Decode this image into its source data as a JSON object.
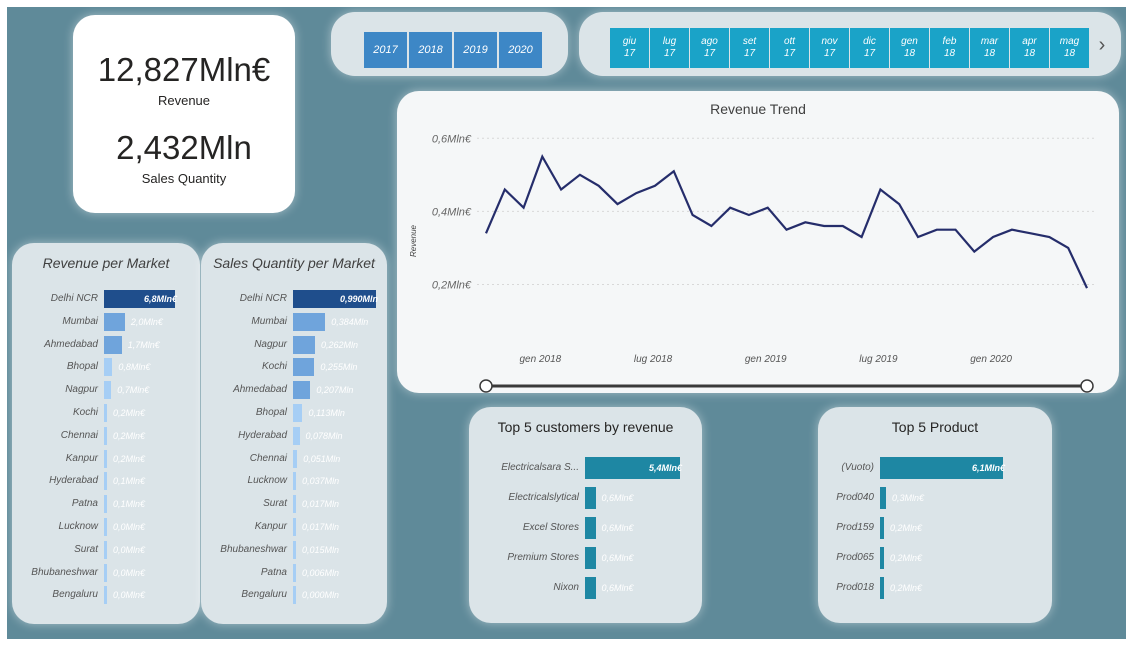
{
  "kpi": {
    "revenue_value": "12,827Mln€",
    "revenue_label": "Revenue",
    "quantity_value": "2,432Mln",
    "quantity_label": "Sales Quantity"
  },
  "year_slicer": [
    "2017",
    "2018",
    "2019",
    "2020"
  ],
  "month_slicer": [
    {
      "m": "giu",
      "y": "17"
    },
    {
      "m": "lug",
      "y": "17"
    },
    {
      "m": "ago",
      "y": "17"
    },
    {
      "m": "set",
      "y": "17"
    },
    {
      "m": "ott",
      "y": "17"
    },
    {
      "m": "nov",
      "y": "17"
    },
    {
      "m": "dic",
      "y": "17"
    },
    {
      "m": "gen",
      "y": "18"
    },
    {
      "m": "feb",
      "y": "18"
    },
    {
      "m": "mar",
      "y": "18"
    },
    {
      "m": "apr",
      "y": "18"
    },
    {
      "m": "mag",
      "y": "18"
    }
  ],
  "month_next_icon": "chevron-right-icon",
  "trend": {
    "title": "Revenue Trend",
    "ylabel": "Revenue",
    "y_ticks": [
      "0,6Mln€",
      "0,4Mln€",
      "0,2Mln€"
    ],
    "x_ticks": [
      "gen 2018",
      "lug 2018",
      "gen 2019",
      "lug 2019",
      "gen 2020"
    ],
    "line_color": "#252d6b"
  },
  "revenue_market": {
    "title": "Revenue per Market",
    "rows": [
      {
        "label": "Delhi NCR",
        "value": "6,8Mln€"
      },
      {
        "label": "Mumbai",
        "value": "2,0Mln€"
      },
      {
        "label": "Ahmedabad",
        "value": "1,7Mln€"
      },
      {
        "label": "Bhopal",
        "value": "0,8Mln€"
      },
      {
        "label": "Nagpur",
        "value": "0,7Mln€"
      },
      {
        "label": "Kochi",
        "value": "0,2Mln€"
      },
      {
        "label": "Chennai",
        "value": "0,2Mln€"
      },
      {
        "label": "Kanpur",
        "value": "0,2Mln€"
      },
      {
        "label": "Hyderabad",
        "value": "0,1Mln€"
      },
      {
        "label": "Patna",
        "value": "0,1Mln€"
      },
      {
        "label": "Lucknow",
        "value": "0,0Mln€"
      },
      {
        "label": "Surat",
        "value": "0,0Mln€"
      },
      {
        "label": "Bhubaneshwar",
        "value": "0,0Mln€"
      },
      {
        "label": "Bengaluru",
        "value": "0,0Mln€"
      }
    ]
  },
  "quantity_market": {
    "title": "Sales Quantity per Market",
    "rows": [
      {
        "label": "Delhi NCR",
        "value": "0,990Mln"
      },
      {
        "label": "Mumbai",
        "value": "0,384Mln"
      },
      {
        "label": "Nagpur",
        "value": "0,262Mln"
      },
      {
        "label": "Kochi",
        "value": "0,255Mln"
      },
      {
        "label": "Ahmedabad",
        "value": "0,207Mln"
      },
      {
        "label": "Bhopal",
        "value": "0,113Mln"
      },
      {
        "label": "Hyderabad",
        "value": "0,078Mln"
      },
      {
        "label": "Chennai",
        "value": "0,051Mln"
      },
      {
        "label": "Lucknow",
        "value": "0,037Mln"
      },
      {
        "label": "Surat",
        "value": "0,017Mln"
      },
      {
        "label": "Kanpur",
        "value": "0,017Mln"
      },
      {
        "label": "Bhubaneshwar",
        "value": "0,015Mln"
      },
      {
        "label": "Patna",
        "value": "0,006Mln"
      },
      {
        "label": "Bengaluru",
        "value": "0,000Mln"
      }
    ]
  },
  "top_customers": {
    "title": "Top 5 customers by revenue",
    "rows": [
      {
        "label": "Electricalsara S...",
        "value": "5,4Mln€"
      },
      {
        "label": "Electricalslytical",
        "value": "0,6Mln€"
      },
      {
        "label": "Excel Stores",
        "value": "0,6Mln€"
      },
      {
        "label": "Premium Stores",
        "value": "0,6Mln€"
      },
      {
        "label": "Nixon",
        "value": "0,6Mln€"
      }
    ]
  },
  "top_products": {
    "title": "Top 5 Product",
    "rows": [
      {
        "label": "(Vuoto)",
        "value": "6,1Mln€"
      },
      {
        "label": "Prod040",
        "value": "0,3Mln€"
      },
      {
        "label": "Prod159",
        "value": "0,2Mln€"
      },
      {
        "label": "Prod065",
        "value": "0,2Mln€"
      },
      {
        "label": "Prod018",
        "value": "0,2Mln€"
      }
    ]
  },
  "chart_data": [
    {
      "type": "line",
      "title": "Revenue Trend",
      "xlabel": "",
      "ylabel": "Revenue",
      "x": [
        "2017-10",
        "2017-11",
        "2017-12",
        "2018-01",
        "2018-02",
        "2018-03",
        "2018-04",
        "2018-05",
        "2018-06",
        "2018-07",
        "2018-08",
        "2018-09",
        "2018-10",
        "2018-11",
        "2018-12",
        "2019-01",
        "2019-02",
        "2019-03",
        "2019-04",
        "2019-05",
        "2019-06",
        "2019-07",
        "2019-08",
        "2019-09",
        "2019-10",
        "2019-11",
        "2019-12",
        "2020-01",
        "2020-02",
        "2020-03",
        "2020-04",
        "2020-05",
        "2020-06"
      ],
      "y": [
        0.34,
        0.46,
        0.41,
        0.55,
        0.46,
        0.5,
        0.47,
        0.42,
        0.45,
        0.47,
        0.51,
        0.39,
        0.36,
        0.41,
        0.39,
        0.41,
        0.35,
        0.37,
        0.36,
        0.36,
        0.33,
        0.46,
        0.42,
        0.33,
        0.35,
        0.35,
        0.29,
        0.33,
        0.35,
        0.34,
        0.33,
        0.3,
        0.19
      ],
      "ylim": [
        0.1,
        0.62
      ],
      "y_ticks": [
        0.2,
        0.4,
        0.6
      ],
      "x_tick_labels": [
        "gen 2018",
        "lug 2018",
        "gen 2019",
        "lug 2019",
        "gen 2020"
      ],
      "grid": true
    },
    {
      "type": "bar",
      "title": "Revenue per Market",
      "categories": [
        "Delhi NCR",
        "Mumbai",
        "Ahmedabad",
        "Bhopal",
        "Nagpur",
        "Kochi",
        "Chennai",
        "Kanpur",
        "Hyderabad",
        "Patna",
        "Lucknow",
        "Surat",
        "Bhubaneshwar",
        "Bengaluru"
      ],
      "values": [
        6.8,
        2.0,
        1.7,
        0.8,
        0.7,
        0.2,
        0.2,
        0.2,
        0.1,
        0.1,
        0.0,
        0.0,
        0.0,
        0.0
      ],
      "orientation": "horizontal"
    },
    {
      "type": "bar",
      "title": "Sales Quantity per Market",
      "categories": [
        "Delhi NCR",
        "Mumbai",
        "Nagpur",
        "Kochi",
        "Ahmedabad",
        "Bhopal",
        "Hyderabad",
        "Chennai",
        "Lucknow",
        "Surat",
        "Kanpur",
        "Bhubaneshwar",
        "Patna",
        "Bengaluru"
      ],
      "values": [
        0.99,
        0.384,
        0.262,
        0.255,
        0.207,
        0.113,
        0.078,
        0.051,
        0.037,
        0.017,
        0.017,
        0.015,
        0.006,
        0.0
      ],
      "orientation": "horizontal"
    },
    {
      "type": "bar",
      "title": "Top 5 customers by revenue",
      "categories": [
        "Electricalsara S...",
        "Electricalslytical",
        "Excel Stores",
        "Premium Stores",
        "Nixon"
      ],
      "values": [
        5.4,
        0.6,
        0.6,
        0.6,
        0.6
      ],
      "orientation": "horizontal"
    },
    {
      "type": "bar",
      "title": "Top 5 Product",
      "categories": [
        "(Vuoto)",
        "Prod040",
        "Prod159",
        "Prod065",
        "Prod018"
      ],
      "values": [
        6.1,
        0.3,
        0.2,
        0.2,
        0.2
      ],
      "orientation": "horizontal"
    }
  ],
  "colors": {
    "background": "#5f8a99",
    "card_light": "#dbe4e8",
    "year_button": "#3d87c6",
    "month_button": "#1aa3c8",
    "bar_dark": "#1f4e8c",
    "bar_mid": "#6fa4dc",
    "bar_light": "#a6cef5",
    "top_bar": "#1e87a3"
  }
}
